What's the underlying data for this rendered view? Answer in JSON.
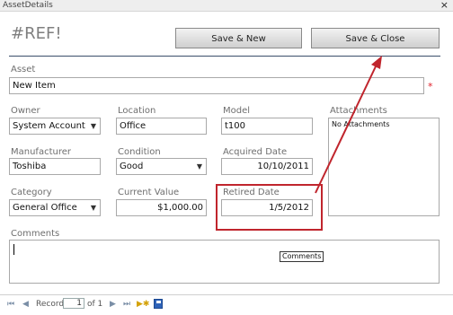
{
  "window": {
    "title": "AssetDetails",
    "close_glyph": "×"
  },
  "form": {
    "title": "#REF!"
  },
  "buttons": {
    "save_new": "Save & New",
    "save_close": "Save & Close"
  },
  "asset": {
    "label": "Asset",
    "value": "New Item",
    "required_mark": "*"
  },
  "owner": {
    "label": "Owner",
    "value": "System Account"
  },
  "location": {
    "label": "Location",
    "value": "Office"
  },
  "model": {
    "label": "Model",
    "value": "t100"
  },
  "attachments": {
    "label": "Attachments",
    "value": "No Attachments"
  },
  "manufacturer": {
    "label": "Manufacturer",
    "value": "Toshiba"
  },
  "condition": {
    "label": "Condition",
    "value": "Good"
  },
  "acquired_date": {
    "label": "Acquired Date",
    "value": "10/10/2011"
  },
  "category": {
    "label": "Category",
    "value": "General Office"
  },
  "current_value": {
    "label": "Current Value",
    "value": "$1,000.00"
  },
  "retired_date": {
    "label": "Retired Date",
    "value": "1/5/2012"
  },
  "comments": {
    "label": "Comments",
    "tooltip": "Comments"
  },
  "navigation": {
    "record_label": "Record",
    "current": "1",
    "of_total": "of 1"
  },
  "colors": {
    "highlight": "#c0252d",
    "required": "#e0202a",
    "title_rule": "#3a4e6b"
  }
}
